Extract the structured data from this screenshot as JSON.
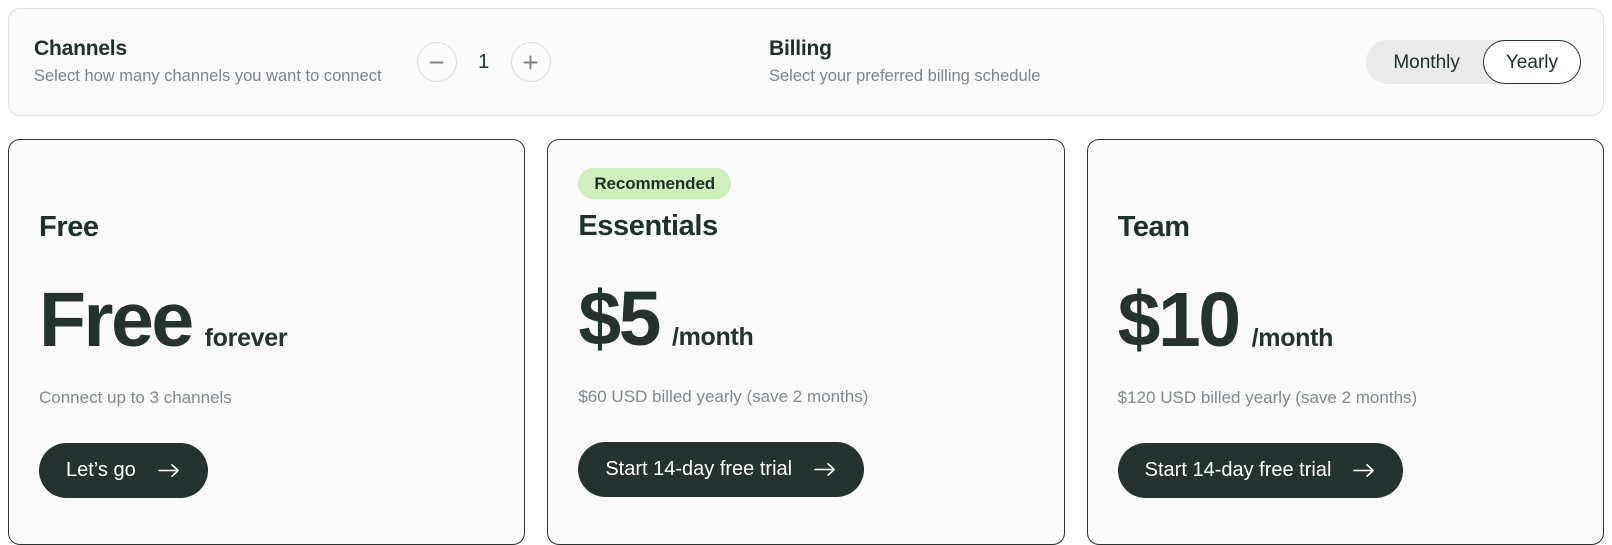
{
  "options": {
    "channels": {
      "title": "Channels",
      "subtitle": "Select how many channels you want to connect",
      "decrement_label": "minus-icon",
      "increment_label": "plus-icon",
      "value": "1"
    },
    "billing": {
      "title": "Billing",
      "subtitle": "Select your preferred billing schedule",
      "options": [
        "Monthly",
        "Yearly"
      ],
      "selected": "Yearly"
    }
  },
  "colors": {
    "dark": "#253330",
    "badge_bg": "#cdf0bd",
    "muted": "#82898d",
    "panel_bg": "#fafafa",
    "toggle_track": "#eaeaea"
  },
  "plans": [
    {
      "badge": null,
      "name": "Free",
      "price": "Free",
      "unit": "forever",
      "note": "Connect up to 3 channels",
      "cta": "Let’s go"
    },
    {
      "badge": "Recommended",
      "name": "Essentials",
      "price": "$5",
      "unit": "/month",
      "note": "$60 USD billed yearly (save 2 months)",
      "cta": "Start 14-day free trial"
    },
    {
      "badge": null,
      "name": "Team",
      "price": "$10",
      "unit": "/month",
      "note": "$120 USD billed yearly (save 2 months)",
      "cta": "Start 14-day free trial"
    }
  ]
}
